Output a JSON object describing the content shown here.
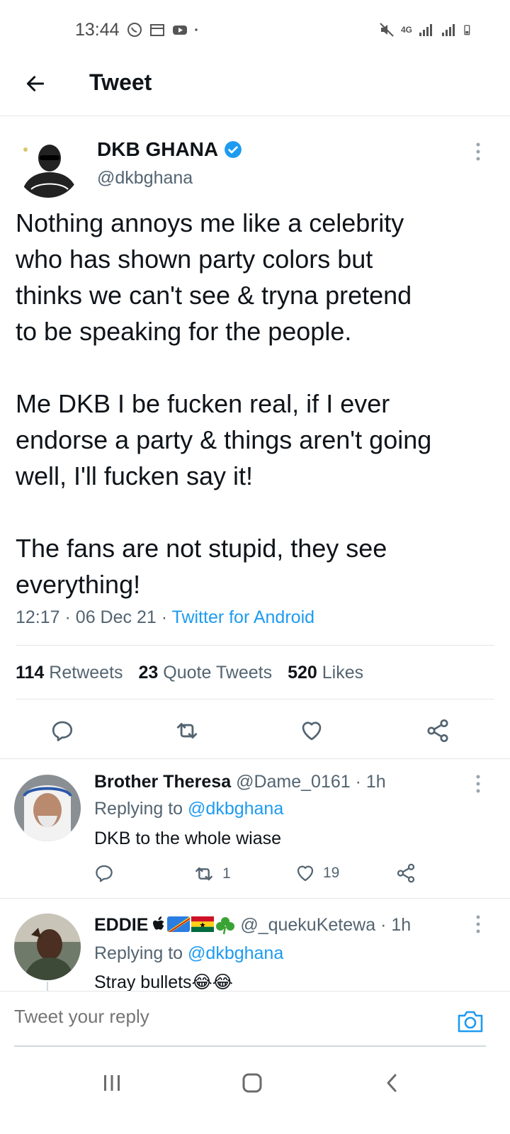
{
  "status_bar": {
    "time": "13:44",
    "network": "4G"
  },
  "header": {
    "title": "Tweet"
  },
  "main_tweet": {
    "author_name": "DKB GHANA",
    "author_handle": "@dkbghana",
    "verified": true,
    "paragraphs": [
      [
        "Nothing annoys me like a celebrity",
        "who has shown party colors but",
        "thinks we can't see & tryna pretend",
        "to be speaking for the people."
      ],
      [
        "Me DKB I be fucken real, if I ever",
        "endorse a party & things aren't going",
        "well, I'll fucken say it!"
      ],
      [
        "The fans are not stupid, they see",
        "everything!"
      ]
    ],
    "time": "12:17",
    "date": "06 Dec 21",
    "source": "Twitter for Android",
    "retweets_count": "114",
    "retweets_label": "Retweets",
    "quote_count": "23",
    "quote_label": "Quote Tweets",
    "likes_count": "520",
    "likes_label": "Likes"
  },
  "replies": [
    {
      "name": "Brother Theresa",
      "handle": "@Dame_0161",
      "age": "1h",
      "replying_prefix": "Replying to",
      "replying_to": "@dkbghana",
      "text": "DKB to the whole wiase",
      "retweets": "1",
      "likes": "19"
    },
    {
      "name": "EDDIE",
      "name_emoji": "",
      "handle": "@_quekuKetewa",
      "age": "1h",
      "replying_prefix": "Replying to",
      "replying_to": "@dkbghana",
      "text": "Stray bullets😂😂"
    }
  ],
  "compose": {
    "placeholder": "Tweet your reply"
  },
  "colors": {
    "accent": "#1d9bf0",
    "text": "#0f1419",
    "muted": "#536471",
    "divider": "#e6e6e6"
  },
  "icons": {
    "back": "arrow-left-icon",
    "verified": "verified-badge-icon",
    "more": "more-vertical-icon",
    "reply": "reply-icon",
    "retweet": "retweet-icon",
    "like": "heart-icon",
    "share": "share-icon",
    "camera": "camera-icon"
  }
}
